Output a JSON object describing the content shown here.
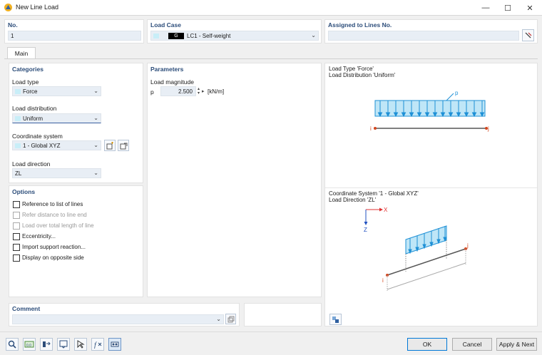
{
  "window": {
    "title": "New Line Load",
    "minimize": "—",
    "maximize": "☐",
    "close": "✕"
  },
  "header": {
    "no_label": "No.",
    "no_value": "1",
    "load_case_label": "Load Case",
    "load_case_tag": "G",
    "load_case_value": "LC1 - Self-weight",
    "assigned_label": "Assigned to Lines No.",
    "assigned_value": ""
  },
  "tabs": [
    {
      "label": "Main"
    }
  ],
  "categories": {
    "title": "Categories",
    "load_type_label": "Load type",
    "load_type_value": "Force",
    "load_distribution_label": "Load distribution",
    "load_distribution_value": "Uniform",
    "coord_system_label": "Coordinate system",
    "coord_system_value": "1 - Global XYZ",
    "load_direction_label": "Load direction",
    "load_direction_value": "ZL"
  },
  "options": {
    "title": "Options",
    "items": [
      {
        "label": "Reference to list of lines",
        "checked": false,
        "enabled": true
      },
      {
        "label": "Refer distance to line end",
        "checked": false,
        "enabled": false
      },
      {
        "label": "Load over total length of line",
        "checked": false,
        "enabled": false
      },
      {
        "label": "Eccentricity...",
        "checked": false,
        "enabled": true
      },
      {
        "label": "Import support reaction...",
        "checked": false,
        "enabled": true
      },
      {
        "label": "Display on opposite side",
        "checked": false,
        "enabled": true
      }
    ]
  },
  "parameters": {
    "title": "Parameters",
    "magnitude_label": "Load magnitude",
    "symbol": "p",
    "value": "2.500",
    "unit": "[kN/m]"
  },
  "diagram_top": {
    "line1": "Load Type 'Force'",
    "line2": "Load Distribution 'Uniform'",
    "p_label": "p",
    "i_label": "i",
    "j_label": "j"
  },
  "diagram_bottom": {
    "line1": "Coordinate System '1 - Global XYZ'",
    "line2": "Load Direction 'ZL'",
    "x_label": "X",
    "z_label": "Z",
    "i_label": "i",
    "j_label": "j"
  },
  "comment": {
    "title": "Comment",
    "value": ""
  },
  "buttons": {
    "ok": "OK",
    "cancel": "Cancel",
    "apply_next": "Apply & Next"
  },
  "colors": {
    "accent": "#2c4d7a",
    "load_fill": "#bfe6f7",
    "load_stroke": "#1e90d6",
    "node": "#d2461e",
    "axis_x": "#e03030",
    "axis_z": "#2050c0"
  }
}
